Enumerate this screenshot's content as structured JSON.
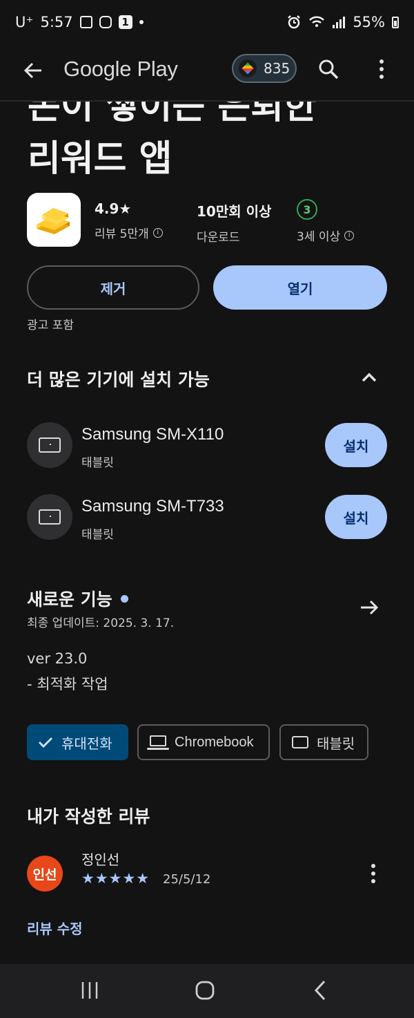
{
  "status_bar": {
    "carrier": "U⁺",
    "time": "5:57",
    "notif_count": "1",
    "battery": "55%"
  },
  "app_bar": {
    "brand": "Google Play",
    "points": "835"
  },
  "app": {
    "title_line1": "돈이 쌓이는 은퇴한",
    "title_line2": "리워드 앱",
    "rating": "4.9★",
    "reviews_label": "리뷰 5만개",
    "downloads": "10만회 이상",
    "downloads_label": "다운로드",
    "age_badge": "3",
    "age_label": "3세 이상",
    "remove_label": "제거",
    "open_label": "열기",
    "ads_note": "광고 포함"
  },
  "devices": {
    "title": "더 많은 기기에 설치 가능",
    "items": [
      {
        "name": "Samsung SM-X110",
        "type": "태블릿",
        "button": "설치"
      },
      {
        "name": "Samsung SM-T733",
        "type": "태블릿",
        "button": "설치"
      }
    ]
  },
  "whats_new": {
    "title": "새로운 기능",
    "updated": "최종 업데이트: 2025. 3. 17.",
    "version": "ver 23.0",
    "note": "- 최적화 작업"
  },
  "chips": {
    "phone": "휴대전화",
    "chromebook": "Chromebook",
    "tablet": "태블릿"
  },
  "my_review": {
    "title": "내가 작성한 리뷰",
    "avatar_text": "인선",
    "name": "정인선",
    "stars": "★★★★★",
    "star_rating": 5,
    "date": "25/5/12",
    "edit_label": "리뷰 수정"
  }
}
